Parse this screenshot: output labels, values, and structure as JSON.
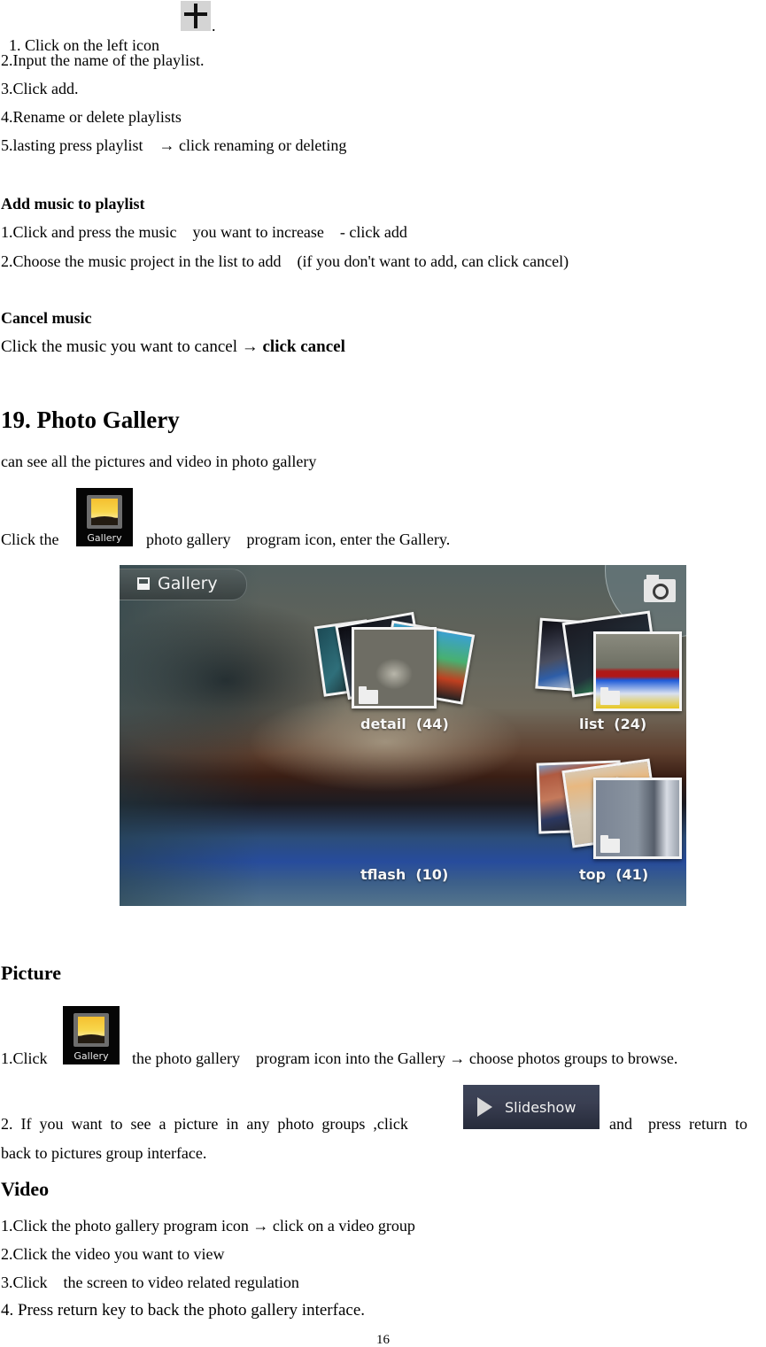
{
  "playlist_steps": [
    "1. Click on the left icon ",
    "2.Input the name of the playlist.",
    "3.Click add.",
    "4.Rename or delete playlists",
    "5.lasting press playlist    → click renaming or deleting"
  ],
  "step1_suffix": ".",
  "add_music": {
    "heading": "Add music to playlist",
    "steps": [
      "1.Click and press the music    you want to increase    - click add",
      "2.Choose the music project in the list to add    (if you don't want to add, can click cancel)"
    ]
  },
  "cancel_music": {
    "heading": "Cancel music",
    "text": "Click the music you want to cancel → ",
    "bold_text": "click cancel"
  },
  "photo_gallery": {
    "heading": "19. Photo Gallery",
    "intro": "can see all the pictures and video in photo gallery",
    "click_prefix": "Click the ",
    "click_suffix": "  photo gallery    program icon, enter the Gallery.",
    "app_icon_label": "Gallery"
  },
  "screenshot": {
    "title": "Gallery",
    "albums": [
      {
        "name": "detail",
        "count": "(44)",
        "label": "detail  (44)"
      },
      {
        "name": "list",
        "count": "(24)",
        "label": "list  (24)"
      },
      {
        "name": "tflash",
        "count": "(10)",
        "label": "tflash  (10)"
      },
      {
        "name": "top",
        "count": "(41)",
        "label": "top  (41)"
      }
    ]
  },
  "picture": {
    "heading": "Picture",
    "step1_prefix": "1.Click ",
    "step1_suffix": "  the photo gallery    program icon into the Gallery → choose photos groups to browse.",
    "step2_prefix": "2.  If  you  want  to  see  a  picture  in  any  photo  groups  ,click ",
    "step2_suffix": "and    press  return  to",
    "step2_line2": "back to pictures group interface.",
    "slideshow_label": "Slideshow"
  },
  "video": {
    "heading": "Video",
    "steps": [
      "1.Click the photo gallery program icon → click on a video group",
      "2.Click the video you want to view",
      "3.Click    the screen to video related regulation",
      "4. Press return key to back the photo gallery interface."
    ]
  },
  "page_number": "16"
}
